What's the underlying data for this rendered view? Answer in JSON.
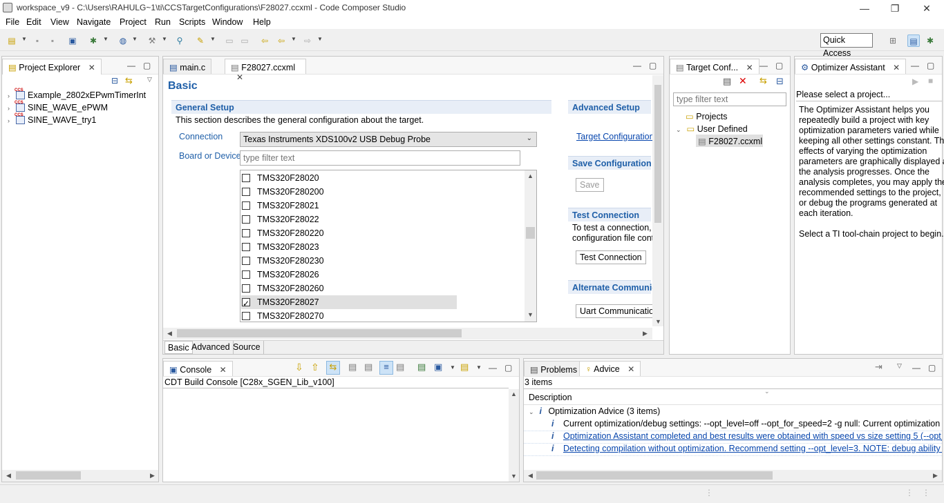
{
  "window": {
    "title": "workspace_v9 - C:\\Users\\RAHULG~1\\ti\\CCSTargetConfigurations\\F28027.ccxml - Code Composer Studio",
    "controls": [
      "—",
      "❐",
      "✕"
    ]
  },
  "menu": [
    "File",
    "Edit",
    "View",
    "Navigate",
    "Project",
    "Run",
    "Scripts",
    "Window",
    "Help"
  ],
  "toolbar": {
    "quick_access": "Quick Access"
  },
  "project_explorer": {
    "title": "Project Explorer",
    "projects": [
      "Example_2802xEPwmTimerInt",
      "SINE_WAVE_ePWM",
      "SINE_WAVE_try1"
    ]
  },
  "editor": {
    "tabs": [
      {
        "label": "main.c"
      },
      {
        "label": "F28027.ccxml"
      }
    ],
    "heading": "Basic",
    "general_setup": {
      "title": "General Setup",
      "description": "This section describes the general configuration about the target.",
      "connection_label": "Connection",
      "connection_value": "Texas Instruments XDS100v2 USB Debug Probe",
      "board_label": "Board or Device",
      "filter_placeholder": "type filter text",
      "devices": [
        {
          "name": "TMS320F28020",
          "checked": false
        },
        {
          "name": "TMS320F280200",
          "checked": false
        },
        {
          "name": "TMS320F28021",
          "checked": false
        },
        {
          "name": "TMS320F28022",
          "checked": false
        },
        {
          "name": "TMS320F280220",
          "checked": false
        },
        {
          "name": "TMS320F28023",
          "checked": false
        },
        {
          "name": "TMS320F280230",
          "checked": false
        },
        {
          "name": "TMS320F28026",
          "checked": false
        },
        {
          "name": "TMS320F280260",
          "checked": false
        },
        {
          "name": "TMS320F28027",
          "checked": true
        },
        {
          "name": "TMS320F280270",
          "checked": false
        }
      ]
    },
    "advanced_setup": {
      "title": "Advanced Setup",
      "link": "Target Configuration"
    },
    "save_configuration": {
      "title": "Save Configuration",
      "button": "Save"
    },
    "test_connection": {
      "title": "Test Connection",
      "text_line1": "To test a connection, a",
      "text_line2": "configuration file cont",
      "button": "Test Connection"
    },
    "alternate": {
      "title": "Alternate Communic",
      "button": "Uart Communicatio"
    },
    "bottom_tabs": [
      "Basic",
      "Advanced",
      "Source"
    ]
  },
  "target_conf": {
    "title": "Target Conf...",
    "filter_placeholder": "type filter text",
    "tree": [
      {
        "label": "Projects",
        "level": 0,
        "expanded": false
      },
      {
        "label": "User Defined",
        "level": 0,
        "expanded": true
      },
      {
        "label": "F28027.ccxml",
        "level": 1,
        "selected": true
      }
    ]
  },
  "optimizer": {
    "title": "Optimizer Assistant",
    "prompt": "Please select a project...",
    "body_lines": [
      "The Optimizer Assistant helps you",
      "repeatedly build a project with key",
      "optimization parameters varied while",
      "keeping all other settings constant. The",
      "effects of varying the optimization",
      "parameters are graphically displayed as",
      "the analysis progresses. Once the",
      "analysis completes, you may apply the",
      "recommended settings to the project,",
      "or debug the programs generated at",
      "each iteration."
    ],
    "footer": "Select a TI tool-chain project to begin..."
  },
  "console": {
    "title": "Console",
    "subtitle": "CDT Build Console [C28x_SGEN_Lib_v100]"
  },
  "advice": {
    "tabs": [
      "Problems",
      "Advice"
    ],
    "count": "3 items",
    "column": "Description",
    "group": "Optimization Advice (3 items)",
    "items": [
      "Current optimization/debug settings:  --opt_level=off  --opt_for_speed=2   -g null: Current optimization",
      "Optimization Assistant completed and best results were obtained with speed vs size setting 5 (--opt_for_s",
      "Detecting compilation without optimization. Recommend setting --opt_level=3. NOTE: debug ability wil"
    ]
  },
  "colors": {
    "accent": "#1f5fa8",
    "link": "#0645ad",
    "selection": "#e0e0e0"
  }
}
